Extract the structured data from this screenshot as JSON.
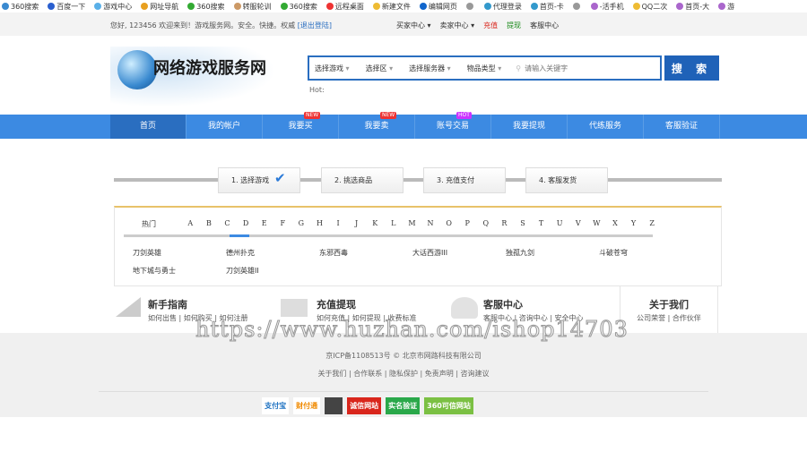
{
  "bookmarks": [
    "360搜索",
    "百度一下",
    "游戏中心",
    "网址导航",
    "360搜索",
    "转服轮训",
    "360搜索",
    "远程桌面",
    "新建文件",
    "编辑网页",
    "",
    "代理登录",
    "首页-卡",
    "",
    "-活手机",
    "QQ二次",
    "首页-大",
    "游"
  ],
  "topbar": {
    "greeting": "您好, 123456  欢迎来到！游戏服务网。安全。快捷。权威",
    "logout": "[退出登陆]",
    "menu": [
      {
        "label": "买家中心 ▾",
        "color": "#333"
      },
      {
        "label": "卖家中心 ▾",
        "color": "#333"
      },
      {
        "label": "充值",
        "color": "#d9261c"
      },
      {
        "label": "提现",
        "color": "#1a8a1a"
      },
      {
        "label": "客服中心",
        "color": "#333"
      }
    ]
  },
  "logo": {
    "text": "网络游戏服务网"
  },
  "search": {
    "selects": [
      "选择游戏",
      "选择区",
      "选择服务器",
      "物品类型"
    ],
    "placeholder": "请输入关键字",
    "button": "搜 索",
    "hot": "Hot:"
  },
  "nav": [
    {
      "label": "首页",
      "active": true
    },
    {
      "label": "我的帐户"
    },
    {
      "label": "我要买",
      "badge": "NEW"
    },
    {
      "label": "我要卖",
      "badge": "NEW"
    },
    {
      "label": "账号交易",
      "badge": "HOT"
    },
    {
      "label": "我要提现"
    },
    {
      "label": "代练服务"
    },
    {
      "label": "客服验证"
    }
  ],
  "steps": [
    "1. 选择游戏",
    "2. 挑选商品",
    "3. 充值支付",
    "4. 客服发货"
  ],
  "letters": {
    "hot": "热门",
    "items": [
      "A",
      "B",
      "C",
      "D",
      "E",
      "F",
      "G",
      "H",
      "I",
      "J",
      "K",
      "L",
      "M",
      "N",
      "O",
      "P",
      "Q",
      "R",
      "S",
      "T",
      "U",
      "V",
      "W",
      "X",
      "Y",
      "Z"
    ],
    "selected": "D"
  },
  "games": [
    "刀剑英雄",
    "德州扑克",
    "东邪西毒",
    "大话西游III",
    "独孤九剑",
    "斗破苍穹",
    "地下城与勇士",
    "刀剑英雄II"
  ],
  "guide": [
    {
      "title": "新手指南",
      "links": "如何出售 | 如何购买 | 如何注册"
    },
    {
      "title": "充值提现",
      "links": "如何充值 | 如何提现 | 收费标准"
    },
    {
      "title": "客服中心",
      "links": "客服中心 | 咨询中心 | 安全中心"
    },
    {
      "title": "关于我们",
      "links": "公司荣誉 | 合作伙伴"
    }
  ],
  "footer": {
    "icp": "京ICP备1108513号 © 北京市网路科技有限公司",
    "links": "关于我们 | 合作联系 | 隐私保护 | 免责声明 | 咨询建议",
    "badges": [
      "支付宝",
      "财付通",
      "",
      "诚信网站",
      "实名验证",
      "360可信网站"
    ]
  },
  "watermark": "https://www.huzhan.com/ishop14703"
}
